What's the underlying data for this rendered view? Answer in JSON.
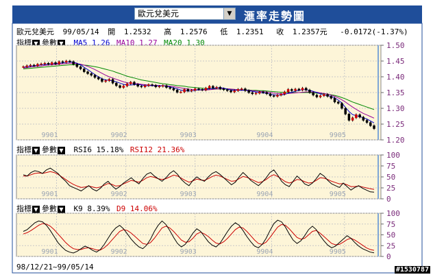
{
  "header": {
    "selected_pair": "歐元兌美元",
    "title": "滙率走勢圖"
  },
  "quote": {
    "name": "歐元兌美元",
    "date": "99/05/14",
    "open_label": "開",
    "open": "1.2532",
    "high_label": "高",
    "high": "1.2576",
    "low_label": "低",
    "low": "1.2351",
    "close_label": "收",
    "close": "1.2357元",
    "change": "-0.0172(-1.37%)"
  },
  "controls": {
    "indicator_label": "指標",
    "param_label": "參數",
    "dropdown_arrow": "▼"
  },
  "colors": {
    "header_bg": "#1f4e9a",
    "plot_bg": "#fdf5d8",
    "ma5": "#0000cc",
    "ma10": "#990099",
    "ma20": "#008800",
    "rsi6": "#000000",
    "rsi12": "#cc0000",
    "axis_label": "#7a2a7a",
    "month_label": "#9aa4b4"
  },
  "footer": {
    "range": "98/12/21~99/05/14"
  },
  "counter": "#1530787",
  "chart_data": [
    {
      "type": "line",
      "name": "price",
      "legend": [
        {
          "name": "MA5",
          "value": "1.26"
        },
        {
          "name": "MA10",
          "value": "1.27"
        },
        {
          "name": "MA20",
          "value": "1.30"
        }
      ],
      "months": [
        "9901",
        "9902",
        "9903",
        "9904",
        "9905"
      ],
      "yticks": [
        "1.50",
        "1.45",
        "1.40",
        "1.35",
        "1.30",
        "1.25",
        "1.20"
      ],
      "ylim": [
        1.2,
        1.5
      ],
      "close": [
        1.432,
        1.435,
        1.437,
        1.435,
        1.44,
        1.441,
        1.443,
        1.44,
        1.445,
        1.441,
        1.448,
        1.446,
        1.45,
        1.448,
        1.44,
        1.432,
        1.425,
        1.416,
        1.41,
        1.405,
        1.398,
        1.393,
        1.385,
        1.388,
        1.392,
        1.38,
        1.372,
        1.366,
        1.371,
        1.378,
        1.383,
        1.376,
        1.37,
        1.368,
        1.372,
        1.375,
        1.373,
        1.368,
        1.37,
        1.372,
        1.366,
        1.363,
        1.358,
        1.351,
        1.352,
        1.36,
        1.355,
        1.357,
        1.362,
        1.36,
        1.358,
        1.364,
        1.37,
        1.365,
        1.367,
        1.362,
        1.359,
        1.356,
        1.352,
        1.356,
        1.36,
        1.362,
        1.356,
        1.35,
        1.346,
        1.348,
        1.352,
        1.35,
        1.346,
        1.34,
        1.338,
        1.342,
        1.345,
        1.352,
        1.36,
        1.356,
        1.361,
        1.358,
        1.364,
        1.358,
        1.35,
        1.342,
        1.336,
        1.34,
        1.344,
        1.338,
        1.332,
        1.32,
        1.316,
        1.3,
        1.282,
        1.262,
        1.27,
        1.28,
        1.272,
        1.262,
        1.255,
        1.245,
        1.2357
      ],
      "ma5": [
        1.43,
        1.432,
        1.434,
        1.435,
        1.436,
        1.438,
        1.439,
        1.44,
        1.442,
        1.442,
        1.443,
        1.444,
        1.446,
        1.447,
        1.446,
        1.443,
        1.438,
        1.43,
        1.423,
        1.415,
        1.407,
        1.4,
        1.394,
        1.39,
        1.389,
        1.387,
        1.384,
        1.38,
        1.376,
        1.374,
        1.374,
        1.375,
        1.376,
        1.374,
        1.372,
        1.372,
        1.372,
        1.371,
        1.371,
        1.371,
        1.37,
        1.368,
        1.365,
        1.362,
        1.358,
        1.356,
        1.355,
        1.355,
        1.357,
        1.359,
        1.359,
        1.36,
        1.362,
        1.363,
        1.365,
        1.366,
        1.364,
        1.361,
        1.358,
        1.357,
        1.357,
        1.357,
        1.357,
        1.356,
        1.354,
        1.352,
        1.35,
        1.349,
        1.348,
        1.345,
        1.343,
        1.342,
        1.342,
        1.344,
        1.348,
        1.351,
        1.354,
        1.357,
        1.359,
        1.359,
        1.357,
        1.354,
        1.35,
        1.346,
        1.342,
        1.34,
        1.338,
        1.333,
        1.326,
        1.317,
        1.303,
        1.29,
        1.28,
        1.277,
        1.274,
        1.27,
        1.266,
        1.26,
        1.254
      ],
      "ma10": [
        1.428,
        1.429,
        1.431,
        1.432,
        1.433,
        1.434,
        1.436,
        1.437,
        1.438,
        1.439,
        1.44,
        1.441,
        1.442,
        1.443,
        1.443,
        1.442,
        1.44,
        1.437,
        1.433,
        1.428,
        1.423,
        1.417,
        1.411,
        1.405,
        1.4,
        1.396,
        1.392,
        1.388,
        1.384,
        1.381,
        1.38,
        1.379,
        1.378,
        1.376,
        1.375,
        1.374,
        1.373,
        1.373,
        1.372,
        1.372,
        1.371,
        1.37,
        1.369,
        1.367,
        1.365,
        1.363,
        1.361,
        1.36,
        1.359,
        1.358,
        1.358,
        1.358,
        1.359,
        1.36,
        1.361,
        1.362,
        1.362,
        1.362,
        1.361,
        1.36,
        1.359,
        1.358,
        1.358,
        1.357,
        1.356,
        1.355,
        1.354,
        1.353,
        1.352,
        1.35,
        1.348,
        1.347,
        1.346,
        1.346,
        1.347,
        1.348,
        1.349,
        1.35,
        1.351,
        1.352,
        1.352,
        1.352,
        1.351,
        1.349,
        1.347,
        1.345,
        1.342,
        1.338,
        1.333,
        1.327,
        1.32,
        1.312,
        1.304,
        1.297,
        1.29,
        1.284,
        1.279,
        1.274,
        1.269
      ],
      "ma20": [
        1.425,
        1.426,
        1.427,
        1.428,
        1.429,
        1.43,
        1.431,
        1.432,
        1.433,
        1.434,
        1.435,
        1.436,
        1.437,
        1.438,
        1.438,
        1.438,
        1.438,
        1.437,
        1.436,
        1.434,
        1.432,
        1.43,
        1.427,
        1.424,
        1.421,
        1.418,
        1.414,
        1.41,
        1.406,
        1.402,
        1.399,
        1.396,
        1.393,
        1.39,
        1.388,
        1.386,
        1.384,
        1.382,
        1.38,
        1.378,
        1.377,
        1.375,
        1.374,
        1.372,
        1.371,
        1.37,
        1.368,
        1.367,
        1.366,
        1.365,
        1.364,
        1.363,
        1.363,
        1.362,
        1.362,
        1.361,
        1.361,
        1.361,
        1.36,
        1.36,
        1.359,
        1.359,
        1.358,
        1.358,
        1.357,
        1.357,
        1.356,
        1.356,
        1.355,
        1.354,
        1.353,
        1.352,
        1.351,
        1.351,
        1.351,
        1.35,
        1.35,
        1.35,
        1.35,
        1.35,
        1.35,
        1.349,
        1.348,
        1.347,
        1.346,
        1.345,
        1.343,
        1.341,
        1.338,
        1.334,
        1.33,
        1.325,
        1.32,
        1.316,
        1.312,
        1.308,
        1.304,
        1.3,
        1.296
      ]
    },
    {
      "type": "line",
      "name": "rsi",
      "legend": [
        {
          "name": "RSI6",
          "value": "15.18%"
        },
        {
          "name": "RSI12",
          "value": "21.36%"
        }
      ],
      "months": [
        "9901",
        "9902",
        "9903",
        "9904",
        "9905"
      ],
      "yticks": [
        "100",
        "75",
        "50",
        "25",
        "0"
      ],
      "ylim": [
        0,
        100
      ],
      "rsi6": [
        55,
        52,
        60,
        64,
        62,
        58,
        66,
        70,
        64,
        58,
        48,
        40,
        30,
        26,
        22,
        18,
        24,
        30,
        22,
        18,
        24,
        34,
        40,
        30,
        22,
        28,
        36,
        42,
        48,
        40,
        34,
        46,
        56,
        60,
        52,
        46,
        40,
        48,
        58,
        64,
        56,
        44,
        36,
        30,
        42,
        50,
        44,
        40,
        50,
        58,
        62,
        56,
        48,
        40,
        32,
        38,
        50,
        60,
        52,
        42,
        36,
        30,
        38,
        48,
        60,
        66,
        54,
        40,
        32,
        28,
        40,
        52,
        44,
        34,
        30,
        36,
        46,
        58,
        52,
        42,
        34,
        30,
        26,
        36,
        28,
        20,
        26,
        30,
        24,
        20,
        16,
        15.18
      ],
      "rsi12": [
        52,
        52,
        55,
        58,
        59,
        58,
        60,
        62,
        60,
        56,
        50,
        44,
        38,
        33,
        29,
        26,
        27,
        29,
        27,
        25,
        27,
        31,
        35,
        33,
        29,
        30,
        34,
        38,
        42,
        40,
        38,
        42,
        48,
        51,
        49,
        46,
        44,
        46,
        50,
        54,
        52,
        47,
        42,
        38,
        41,
        45,
        43,
        42,
        46,
        51,
        54,
        52,
        48,
        44,
        40,
        41,
        46,
        51,
        49,
        45,
        41,
        37,
        39,
        44,
        51,
        55,
        51,
        45,
        39,
        36,
        39,
        44,
        43,
        39,
        36,
        37,
        42,
        48,
        47,
        44,
        40,
        37,
        34,
        35,
        32,
        28,
        28,
        29,
        27,
        25,
        23,
        21.36
      ]
    },
    {
      "type": "line",
      "name": "kd",
      "legend": [
        {
          "name": "K9",
          "value": "8.39%"
        },
        {
          "name": "D9",
          "value": "14.06%"
        }
      ],
      "months": [
        "9901",
        "9902",
        "9903",
        "9904",
        "9905"
      ],
      "yticks": [
        "100",
        "75",
        "50",
        "25",
        "0"
      ],
      "ylim": [
        0,
        100
      ],
      "k9": [
        58,
        62,
        70,
        78,
        82,
        80,
        72,
        60,
        46,
        32,
        22,
        14,
        10,
        8,
        12,
        18,
        24,
        20,
        14,
        10,
        16,
        28,
        42,
        56,
        66,
        72,
        64,
        52,
        40,
        30,
        22,
        18,
        26,
        40,
        58,
        72,
        82,
        74,
        60,
        44,
        30,
        22,
        28,
        40,
        54,
        64,
        58,
        46,
        34,
        26,
        22,
        30,
        44,
        58,
        70,
        78,
        72,
        60,
        46,
        34,
        24,
        20,
        28,
        42,
        60,
        76,
        84,
        80,
        68,
        52,
        38,
        30,
        36,
        48,
        62,
        70,
        62,
        48,
        36,
        26,
        20,
        24,
        32,
        40,
        48,
        42,
        32,
        24,
        18,
        14,
        10,
        8.39
      ],
      "d9": [
        52,
        55,
        60,
        66,
        72,
        76,
        75,
        70,
        62,
        52,
        42,
        32,
        24,
        18,
        16,
        16,
        19,
        20,
        18,
        15,
        15,
        20,
        28,
        38,
        48,
        58,
        62,
        60,
        54,
        46,
        38,
        30,
        28,
        32,
        42,
        54,
        66,
        70,
        66,
        58,
        48,
        38,
        33,
        34,
        42,
        52,
        56,
        52,
        46,
        38,
        31,
        29,
        34,
        42,
        52,
        62,
        68,
        66,
        58,
        48,
        38,
        30,
        28,
        33,
        44,
        56,
        68,
        74,
        72,
        64,
        54,
        44,
        40,
        42,
        50,
        58,
        60,
        54,
        46,
        38,
        30,
        27,
        28,
        33,
        39,
        42,
        38,
        32,
        26,
        20,
        16,
        14.06
      ]
    }
  ]
}
